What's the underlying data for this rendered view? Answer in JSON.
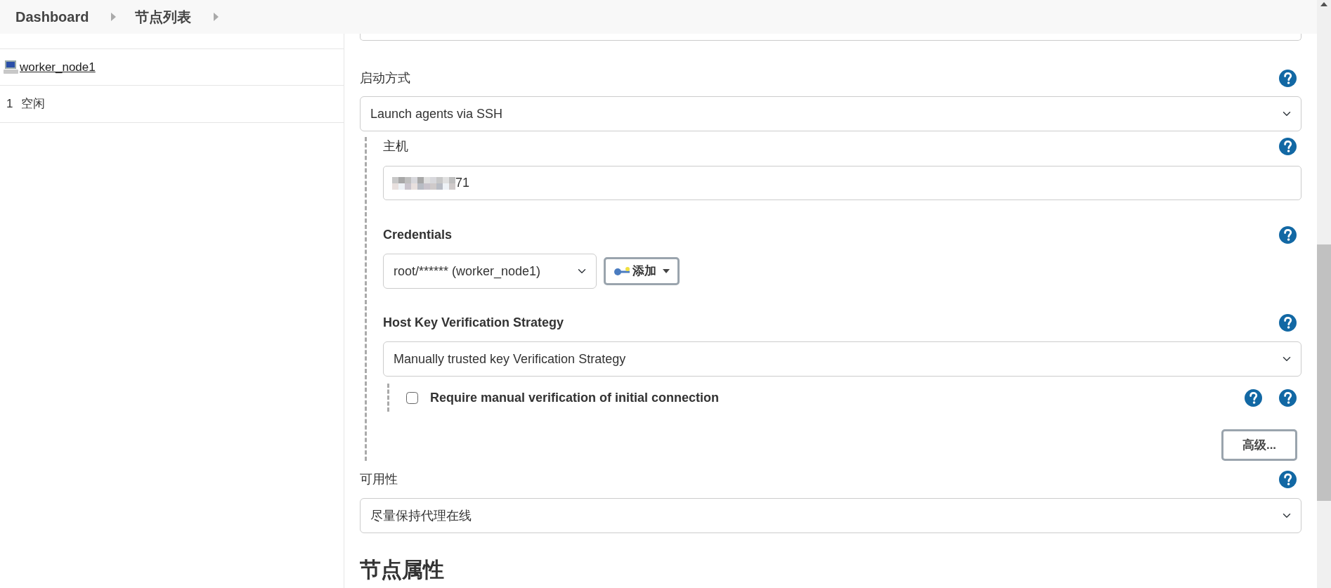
{
  "breadcrumbs": [
    {
      "label": "Dashboard"
    },
    {
      "label": "节点列表"
    }
  ],
  "sidebar": {
    "node": {
      "name": "worker_node1"
    },
    "executors": [
      {
        "number": "1",
        "status": "空闲"
      }
    ]
  },
  "form": {
    "launch_method": {
      "label": "启动方式",
      "value": "Launch agents via SSH"
    },
    "ssh": {
      "host": {
        "label": "主机",
        "value": "71"
      },
      "credentials": {
        "label": "Credentials",
        "value": "root/****** (worker_node1)",
        "add_button": "添加"
      },
      "host_key": {
        "label": "Host Key Verification Strategy",
        "value": "Manually trusted key Verification Strategy",
        "option": {
          "label": "Require manual verification of initial connection",
          "checked": false
        }
      },
      "advanced_button": "高级..."
    },
    "availability": {
      "label": "可用性",
      "value": "尽量保持代理在线"
    },
    "section_heading": "节点属性"
  }
}
